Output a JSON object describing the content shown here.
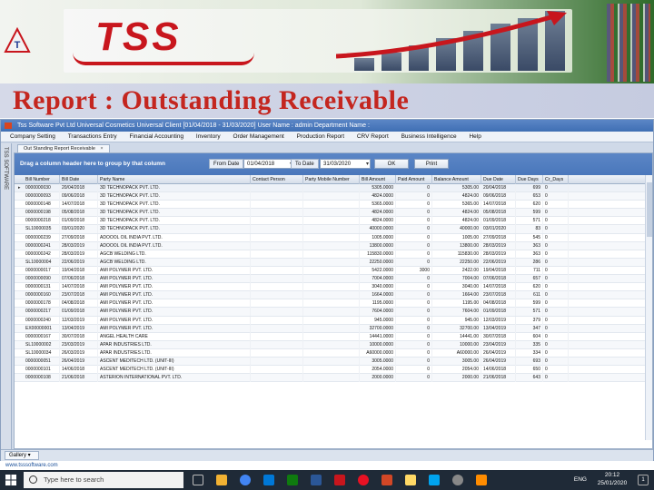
{
  "slide": {
    "logo_text": "TSS",
    "title": "Report : Outstanding Receivable"
  },
  "app": {
    "window_title": "Tss Software Pvt Ltd  Universal Cosmetics  Universal Client  [01/04/2018 - 31/03/2020]  User Name : admin  Department Name :",
    "menu": [
      "Company Setting",
      "Transactions Entry",
      "Financial Accounting",
      "Inventory",
      "Order Management",
      "Production Report",
      "CRV Report",
      "Business Intelligence",
      "Help"
    ],
    "side_tab": "TSS SOFTWARE",
    "doc_tab": "Out Standing Report Receivable",
    "doc_tab_close": "×",
    "group_hint": "Drag a column header here to group by that column",
    "from_date_label": "From Date",
    "from_date_value": "01/04/2018",
    "to_date_label": "To Date",
    "to_date_value": "31/03/2020",
    "ok_label": "OK",
    "print_label": "Print",
    "gallery_label": "Gallery",
    "url": "www.tsssoftware.com"
  },
  "table": {
    "columns": [
      "Bill Number",
      "Bill Date",
      "Party Name",
      "Contact Person",
      "Party Mobile Number",
      "Bill Amount",
      "Paid Amount",
      "Balance Amount",
      "Due Date",
      "Due Days",
      "Cr_Days"
    ],
    "rows": [
      [
        "0000000030",
        "20/04/2018",
        "3D TECHNOPACK PVT. LTD.",
        "",
        "",
        "5305.0000",
        "0",
        "5305.00",
        "20/04/2018",
        "699",
        "0"
      ],
      [
        "0000000093",
        "09/06/2018",
        "3D TECHNOPACK PVT. LTD.",
        "",
        "",
        "4824.0000",
        "0",
        "4824.00",
        "09/06/2018",
        "653",
        "0"
      ],
      [
        "0000000148",
        "14/07/2018",
        "3D TECHNOPACK PVT. LTD.",
        "",
        "",
        "5365.0000",
        "0",
        "5365.00",
        "14/07/2018",
        "620",
        "0"
      ],
      [
        "0000000198",
        "05/08/2018",
        "3D TECHNOPACK PVT. LTD.",
        "",
        "",
        "4824.0000",
        "0",
        "4824.00",
        "05/08/2018",
        "599",
        "0"
      ],
      [
        "0000000218",
        "01/09/2018",
        "3D TECHNOPACK PVT. LTD.",
        "",
        "",
        "4824.0000",
        "0",
        "4824.00",
        "01/09/2018",
        "571",
        "0"
      ],
      [
        "SL10000035",
        "03/01/2020",
        "3D TECHNOPACK PVT. LTD.",
        "",
        "",
        "40000.0000",
        "0",
        "40000.00",
        "03/01/2020",
        "83",
        "0"
      ],
      [
        "0000000239",
        "27/09/2018",
        "ADOOOL OIL INDIA PVT. LTD.",
        "",
        "",
        "1005.0000",
        "0",
        "1005.00",
        "27/09/2018",
        "545",
        "0"
      ],
      [
        "0000000241",
        "28/03/2019",
        "ADOOOL OIL INDIA PVT. LTD.",
        "",
        "",
        "13800.0000",
        "0",
        "13800.00",
        "28/03/2019",
        "363",
        "0"
      ],
      [
        "0000000242",
        "28/03/2019",
        "AGCB WELDING LTD.",
        "",
        "",
        "115830.0000",
        "0",
        "115830.00",
        "28/03/2019",
        "363",
        "0"
      ],
      [
        "SL10000004",
        "22/06/2019",
        "AGCB WELDING LTD.",
        "",
        "",
        "22250.0000",
        "0",
        "22250.00",
        "22/06/2019",
        "286",
        "0"
      ],
      [
        "0000000017",
        "19/04/2018",
        "AMI POLYMER PVT. LTD.",
        "",
        "",
        "5422.0000",
        "3000",
        "2422.00",
        "19/04/2018",
        "711",
        "0"
      ],
      [
        "0000000090",
        "07/06/2018",
        "AMI POLYMER PVT. LTD.",
        "",
        "",
        "7004.0000",
        "0",
        "7004.00",
        "07/06/2018",
        "657",
        "0"
      ],
      [
        "0000000131",
        "14/07/2018",
        "AMI POLYMER PVT. LTD.",
        "",
        "",
        "3040.0000",
        "0",
        "3040.00",
        "14/07/2018",
        "620",
        "0"
      ],
      [
        "0000000160",
        "23/07/2018",
        "AMI POLYMER PVT. LTD.",
        "",
        "",
        "1664.0000",
        "0",
        "1664.00",
        "23/07/2018",
        "611",
        "0"
      ],
      [
        "0000000178",
        "04/08/2018",
        "AMI POLYMER PVT. LTD.",
        "",
        "",
        "1195.0000",
        "0",
        "1195.00",
        "04/08/2018",
        "599",
        "0"
      ],
      [
        "0000000217",
        "01/09/2018",
        "AMI POLYMER PVT. LTD.",
        "",
        "",
        "7604.0000",
        "0",
        "7604.00",
        "01/09/2018",
        "571",
        "0"
      ],
      [
        "0000000240",
        "12/03/2019",
        "AMI POLYMER PVT. LTD.",
        "",
        "",
        "945.0000",
        "0",
        "945.00",
        "12/03/2019",
        "379",
        "0"
      ],
      [
        "EX00000001",
        "13/04/2019",
        "AMI POLYMER PVT. LTD.",
        "",
        "",
        "32700.0000",
        "0",
        "32700.00",
        "13/04/2019",
        "347",
        "0"
      ],
      [
        "0000000167",
        "30/07/2018",
        "ANGEL HEALTH CARE",
        "",
        "",
        "14441.0000",
        "0",
        "14441.00",
        "30/07/2018",
        "604",
        "0"
      ],
      [
        "SL10000002",
        "23/03/2019",
        "APAR INDUSTRIES LTD.",
        "",
        "",
        "10000.0000",
        "0",
        "10000.00",
        "23/04/2019",
        "335",
        "0"
      ],
      [
        "SL10000034",
        "26/03/2019",
        "APAR INDUSTRIES LTD.",
        "",
        "",
        "A60000.0000",
        "0",
        "A60000.00",
        "26/04/2019",
        "334",
        "0"
      ],
      [
        "0000000051",
        "26/04/2019",
        "ASCENT MEDITECH LTD. (UNIT-III)",
        "",
        "",
        "3005.0000",
        "0",
        "3005.00",
        "26/04/2019",
        "693",
        "0"
      ],
      [
        "0000000101",
        "14/06/2018",
        "ASCENT MEDITECH LTD. (UNIT-III)",
        "",
        "",
        "2054.0000",
        "0",
        "2054.00",
        "14/06/2018",
        "650",
        "0"
      ],
      [
        "0000000108",
        "21/06/2018",
        "ASTERION INTERNATIONAL PVT. LTD.",
        "",
        "",
        "2000.0000",
        "0",
        "2000.00",
        "21/06/2018",
        "643",
        "0"
      ]
    ]
  },
  "taskbar": {
    "search_placeholder": "Type here to search",
    "lang": "ENG",
    "time": "20:12",
    "date": "25/01/2020",
    "notification_count": "1"
  },
  "colors": {
    "title_red": "#c4261f",
    "logo_red": "#c8161d",
    "window_blue": "#4a77bb",
    "taskbar_dark": "#1f2a37"
  }
}
